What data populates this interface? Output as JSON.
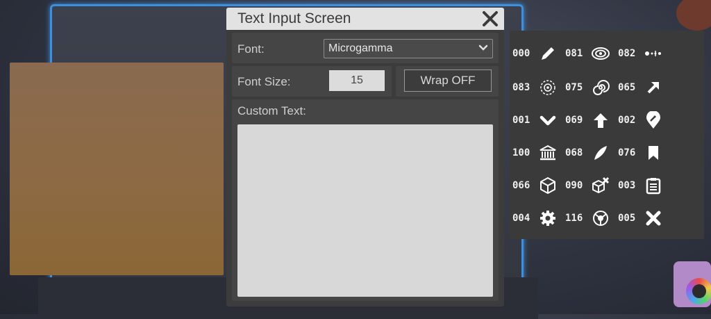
{
  "dialog": {
    "title": "Text Input Screen",
    "font_label": "Font:",
    "font_value": "Microgamma",
    "font_size_label": "Font Size:",
    "font_size_value": "15",
    "wrap_button": "Wrap OFF",
    "custom_text_label": "Custom Text:",
    "custom_text_value": ""
  },
  "palette": {
    "items": [
      {
        "code": "000",
        "icon": "pencil-icon"
      },
      {
        "code": "081",
        "icon": "galaxy-icon"
      },
      {
        "code": "082",
        "icon": "dots-line-icon"
      },
      {
        "code": "083",
        "icon": "target-icon"
      },
      {
        "code": "075",
        "icon": "spiral-icon"
      },
      {
        "code": "065",
        "icon": "arrow-up-right-icon"
      },
      {
        "code": "001",
        "icon": "chevron-down-icon"
      },
      {
        "code": "069",
        "icon": "arrow-up-icon"
      },
      {
        "code": "002",
        "icon": "map-pin-rocket-icon"
      },
      {
        "code": "100",
        "icon": "bank-icon"
      },
      {
        "code": "068",
        "icon": "feather-icon"
      },
      {
        "code": "076",
        "icon": "bookmark-icon"
      },
      {
        "code": "066",
        "icon": "cube-icon"
      },
      {
        "code": "090",
        "icon": "cube-remove-icon"
      },
      {
        "code": "003",
        "icon": "clipboard-icon"
      },
      {
        "code": "004",
        "icon": "gear-icon"
      },
      {
        "code": "116",
        "icon": "emblem-icon"
      },
      {
        "code": "005",
        "icon": "close-x-icon"
      }
    ]
  },
  "colors": {
    "panel_bg": "#3c3c3c",
    "title_bar": "#e2e2e2",
    "frame_glow": "#3d8fe0"
  }
}
